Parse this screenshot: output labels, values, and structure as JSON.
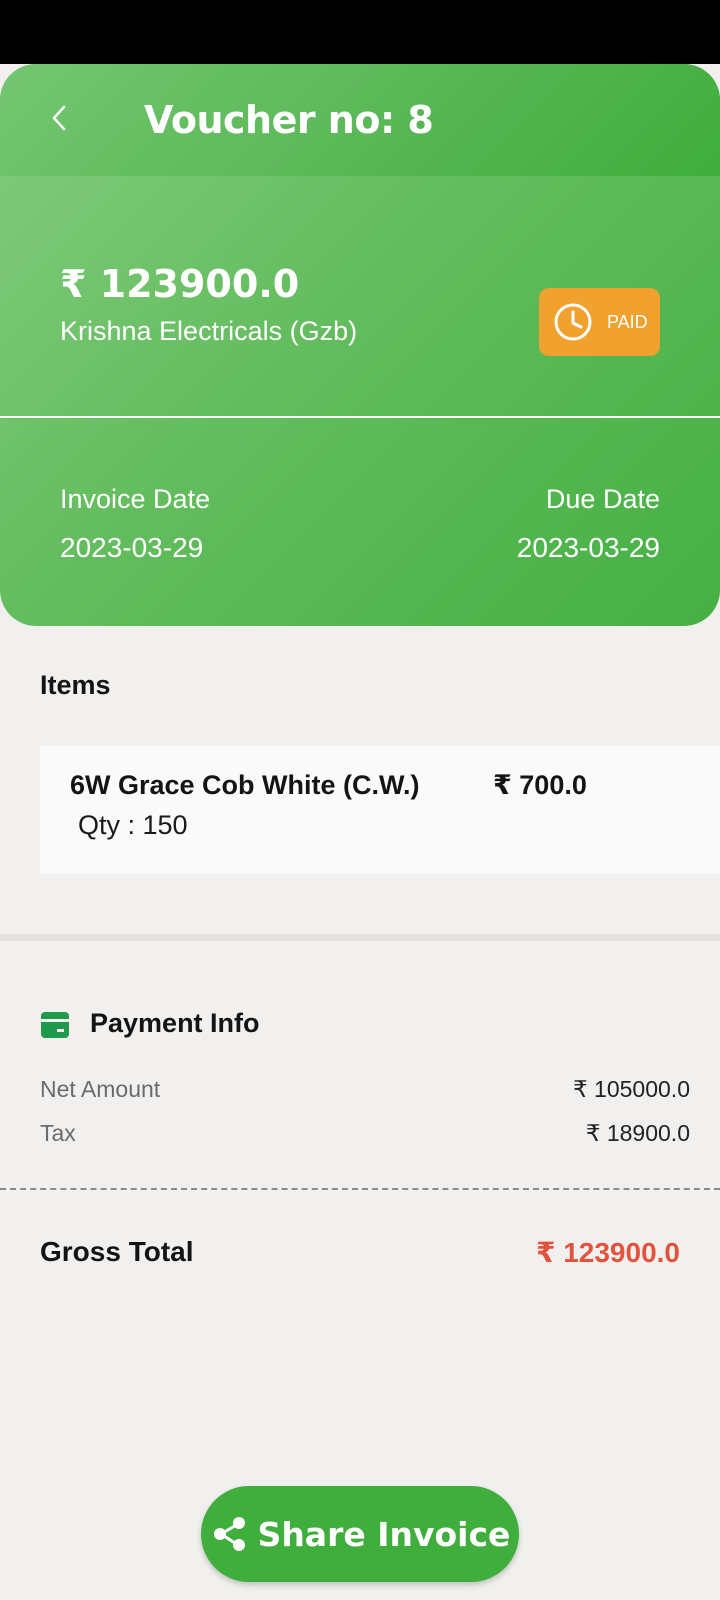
{
  "header": {
    "title": "Voucher no: 8",
    "amount": "₹ 123900.0",
    "party_name": "Krishna Electricals (Gzb)",
    "status": "PAID",
    "invoice_date_label": "Invoice Date",
    "invoice_date": "2023-03-29",
    "due_date_label": "Due Date",
    "due_date": "2023-03-29"
  },
  "items": {
    "heading": "Items",
    "list": [
      {
        "name": "6W Grace Cob White (C.W.)",
        "price": "₹ 700.0",
        "qty": "Qty : 150"
      }
    ]
  },
  "payment": {
    "heading": "Payment Info",
    "net_amount_label": "Net Amount",
    "net_amount": "₹ 105000.0",
    "tax_label": "Tax",
    "tax": "₹ 18900.0",
    "gross_label": "Gross Total",
    "gross": "₹ 123900.0"
  },
  "actions": {
    "share_label": "Share Invoice"
  },
  "colors": {
    "primary_green": "#45b043",
    "status_orange": "#f0a12e",
    "gross_red": "#e0533d",
    "background": "#f1f0ee"
  },
  "icons": [
    "back-arrow-icon",
    "clock-icon",
    "card-icon",
    "share-icon"
  ]
}
